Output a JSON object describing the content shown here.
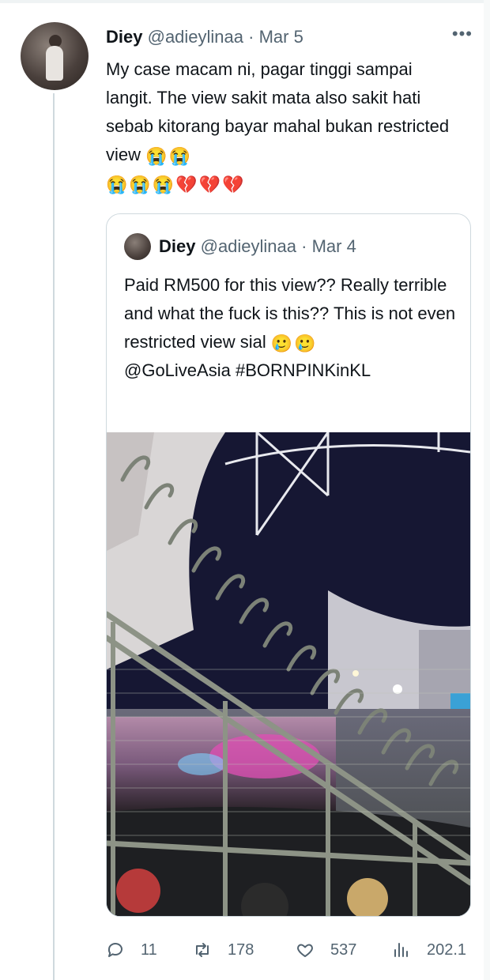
{
  "tweet": {
    "author_name": "Diey",
    "author_handle": "@adieylinaa",
    "separator": "·",
    "date": "Mar 5",
    "more_label": "•••",
    "text": "My case macam ni, pagar tinggi sampai langit. The view sakit mata also sakit hati sebab kitorang bayar mahal bukan restricted view",
    "emoji_trailing": [
      "😭",
      "😭"
    ],
    "emoji_line": [
      "😭",
      "😭",
      "😭",
      "💔",
      "💔",
      "💔"
    ]
  },
  "quote": {
    "author_name": "Diey",
    "author_handle": "@adieylinaa",
    "separator": "·",
    "date": "Mar 4",
    "text": "Paid RM500 for this view?? Really terrible and what the fuck is this?? This is not even restricted view sial",
    "emoji": [
      "🥲",
      "🥲"
    ],
    "mention": "@GoLiveAsia",
    "hashtag": "#BORNPINKinKL",
    "image": "stadium view through a tall metal fence with curved spikes, night sky, stage lights in the distance"
  },
  "actions": {
    "reply": {
      "icon": "reply-icon",
      "count": "11"
    },
    "retweet": {
      "icon": "retweet-icon",
      "count": "178"
    },
    "like": {
      "icon": "heart-icon",
      "count": "537"
    },
    "views": {
      "icon": "views-icon",
      "count": "202.1"
    }
  },
  "colors": {
    "text": "#0f1419",
    "secondary": "#536471",
    "border": "#cfd9de",
    "emoji_cry": "#f2b300",
    "emoji_broken_heart": "#d8233f"
  }
}
